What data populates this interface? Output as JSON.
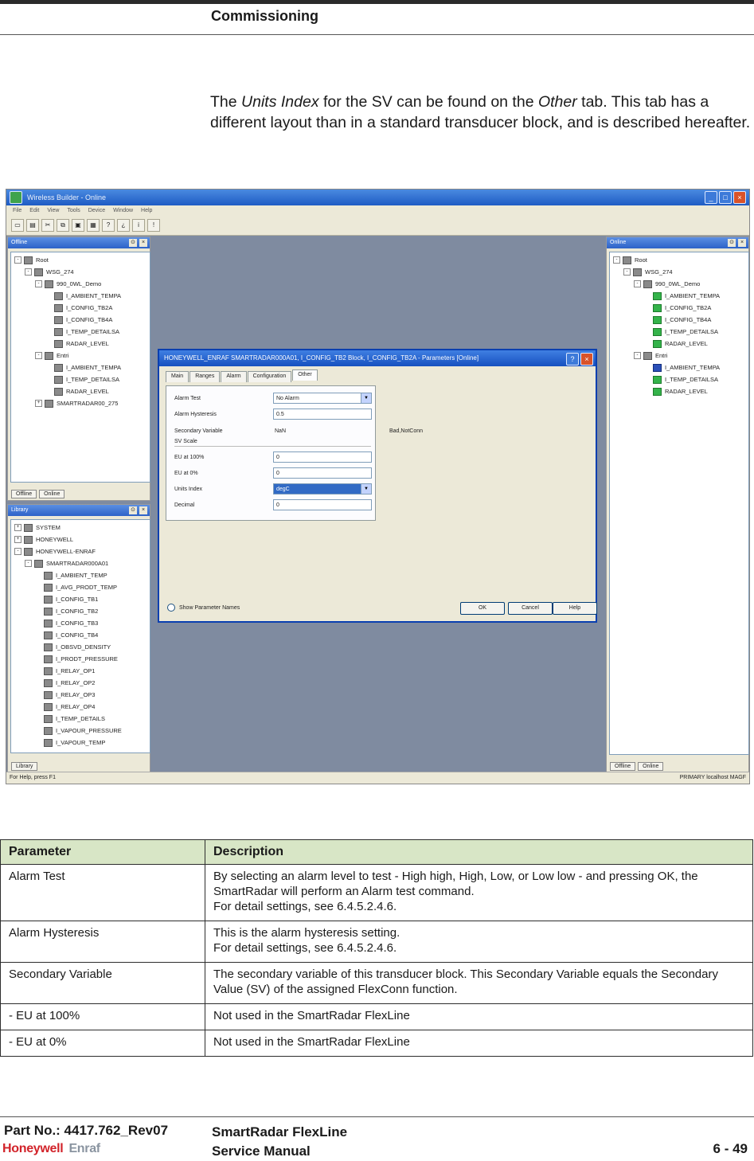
{
  "header": {
    "section_title": "Commissioning"
  },
  "intro": {
    "part1": "The ",
    "units_index": "Units Index",
    "part2": " for the SV can be found on the ",
    "other": "Other",
    "part3": " tab. This tab has a different layout than in a standard transducer block, and is described hereafter."
  },
  "screenshot": {
    "app_title": "Wireless Builder - Online",
    "menu": [
      "File",
      "Edit",
      "View",
      "Tools",
      "Device",
      "Window",
      "Help"
    ],
    "offline_pane": {
      "title": "Offline",
      "tree": [
        {
          "label": "Root",
          "depth": 0,
          "exp": "-"
        },
        {
          "label": "WSG_274",
          "depth": 1,
          "exp": "-"
        },
        {
          "label": "990_0WL_Demo",
          "depth": 2,
          "exp": "-"
        },
        {
          "label": "I_AMBIENT_TEMPA",
          "depth": 3
        },
        {
          "label": "I_CONFIG_TB2A",
          "depth": 3
        },
        {
          "label": "I_CONFIG_TB4A",
          "depth": 3
        },
        {
          "label": "I_TEMP_DETAILSA",
          "depth": 3
        },
        {
          "label": "RADAR_LEVEL",
          "depth": 3
        },
        {
          "label": "Entri",
          "depth": 2,
          "exp": "-"
        },
        {
          "label": "I_AMBIENT_TEMPA",
          "depth": 3
        },
        {
          "label": "I_TEMP_DETAILSA",
          "depth": 3
        },
        {
          "label": "RADAR_LEVEL",
          "depth": 3
        },
        {
          "label": "SMARTRADAR00_275",
          "depth": 2,
          "exp": "+"
        }
      ],
      "footer_tabs": [
        "Offline",
        "Online"
      ]
    },
    "library_pane": {
      "title": "Library",
      "tree": [
        {
          "label": "SYSTEM",
          "depth": 0,
          "exp": "+"
        },
        {
          "label": "HONEYWELL",
          "depth": 0,
          "exp": "+"
        },
        {
          "label": "HONEYWELL-ENRAF",
          "depth": 0,
          "exp": "-"
        },
        {
          "label": "SMARTRADAR000A01",
          "depth": 1,
          "exp": "-"
        },
        {
          "label": "I_AMBIENT_TEMP",
          "depth": 2
        },
        {
          "label": "I_AVG_PRODT_TEMP",
          "depth": 2
        },
        {
          "label": "I_CONFIG_TB1",
          "depth": 2
        },
        {
          "label": "I_CONFIG_TB2",
          "depth": 2
        },
        {
          "label": "I_CONFIG_TB3",
          "depth": 2
        },
        {
          "label": "I_CONFIG_TB4",
          "depth": 2
        },
        {
          "label": "I_OBSVD_DENSITY",
          "depth": 2
        },
        {
          "label": "I_PRODT_PRESSURE",
          "depth": 2
        },
        {
          "label": "I_RELAY_OP1",
          "depth": 2
        },
        {
          "label": "I_RELAY_OP2",
          "depth": 2
        },
        {
          "label": "I_RELAY_OP3",
          "depth": 2
        },
        {
          "label": "I_RELAY_OP4",
          "depth": 2
        },
        {
          "label": "I_TEMP_DETAILS",
          "depth": 2
        },
        {
          "label": "I_VAPOUR_PRESSURE",
          "depth": 2
        },
        {
          "label": "I_VAPOUR_TEMP",
          "depth": 2
        }
      ],
      "footer_tabs": [
        "Library"
      ]
    },
    "online_pane": {
      "title": "Online",
      "tree": [
        {
          "label": "Root",
          "depth": 0,
          "exp": "-"
        },
        {
          "label": "WSG_274",
          "depth": 1,
          "exp": "-"
        },
        {
          "label": "990_0WL_Demo",
          "depth": 2,
          "exp": "-"
        },
        {
          "label": "I_AMBIENT_TEMPA",
          "depth": 3,
          "color": "g"
        },
        {
          "label": "I_CONFIG_TB2A",
          "depth": 3,
          "color": "g"
        },
        {
          "label": "I_CONFIG_TB4A",
          "depth": 3,
          "color": "g"
        },
        {
          "label": "I_TEMP_DETAILSA",
          "depth": 3,
          "color": "g"
        },
        {
          "label": "RADAR_LEVEL",
          "depth": 3,
          "color": "g"
        },
        {
          "label": "Entri",
          "depth": 2,
          "exp": "-"
        },
        {
          "label": "I_AMBIENT_TEMPA",
          "depth": 3,
          "color": "b"
        },
        {
          "label": "I_TEMP_DETAILSA",
          "depth": 3,
          "color": "g"
        },
        {
          "label": "RADAR_LEVEL",
          "depth": 3,
          "color": "g"
        }
      ],
      "footer_tabs": [
        "Offline",
        "Online"
      ]
    },
    "dialog": {
      "title": "HONEYWELL_ENRAF SMARTRADAR000A01, I_CONFIG_TB2 Block, I_CONFIG_TB2A - Parameters [Online]",
      "tabs": [
        "Main",
        "Ranges",
        "Alarm",
        "Configuration",
        "Other"
      ],
      "active_tab": "Other",
      "fields": {
        "alarm_test_label": "Alarm Test",
        "alarm_test_value": "No Alarm",
        "alarm_hysteresis_label": "Alarm Hysteresis",
        "alarm_hysteresis_value": "0.5",
        "secondary_variable_label": "Secondary Variable",
        "secondary_variable_value": "NaN",
        "secondary_variable_status": "Bad,NotConn",
        "sv_scale_label": "SV Scale",
        "eu100_label": "EU at 100%",
        "eu100_value": "0",
        "eu0_label": "EU at 0%",
        "eu0_value": "0",
        "units_index_label": "Units Index",
        "units_index_value": "degC",
        "decimal_label": "Decimal",
        "decimal_value": "0"
      },
      "show_param_names": "Show Parameter Names",
      "ok": "OK",
      "cancel": "Cancel",
      "help": "Help"
    },
    "status": {
      "left": "For Help, press F1",
      "right": "PRIMARY    localhost   MAGF"
    }
  },
  "table": {
    "headers": {
      "parameter": "Parameter",
      "description": "Description"
    },
    "rows": [
      {
        "param": "Alarm Test",
        "desc": "By selecting an alarm level to test - High high, High, Low, or Low low - and pressing OK, the SmartRadar will perform an Alarm test command.\nFor detail settings, see 6.4.5.2.4.6."
      },
      {
        "param": "Alarm Hysteresis",
        "desc": "This is the alarm hysteresis setting.\nFor detail settings, see 6.4.5.2.4.6."
      },
      {
        "param": "Secondary Variable",
        "desc": "The secondary variable of this transducer block. This Secondary Variable equals the Secondary Value (SV) of the assigned FlexConn function."
      },
      {
        "param": "- EU at 100%",
        "desc": "Not used in the SmartRadar FlexLine"
      },
      {
        "param": "- EU at 0%",
        "desc": "Not used in the SmartRadar FlexLine"
      }
    ]
  },
  "footer": {
    "part_no": "Part No.: 4417.762_Rev07",
    "product": "SmartRadar FlexLine",
    "manual": "Service Manual",
    "page": "6 - 49",
    "logo_honeywell": "Honeywell",
    "logo_enraf": "Enraf"
  }
}
